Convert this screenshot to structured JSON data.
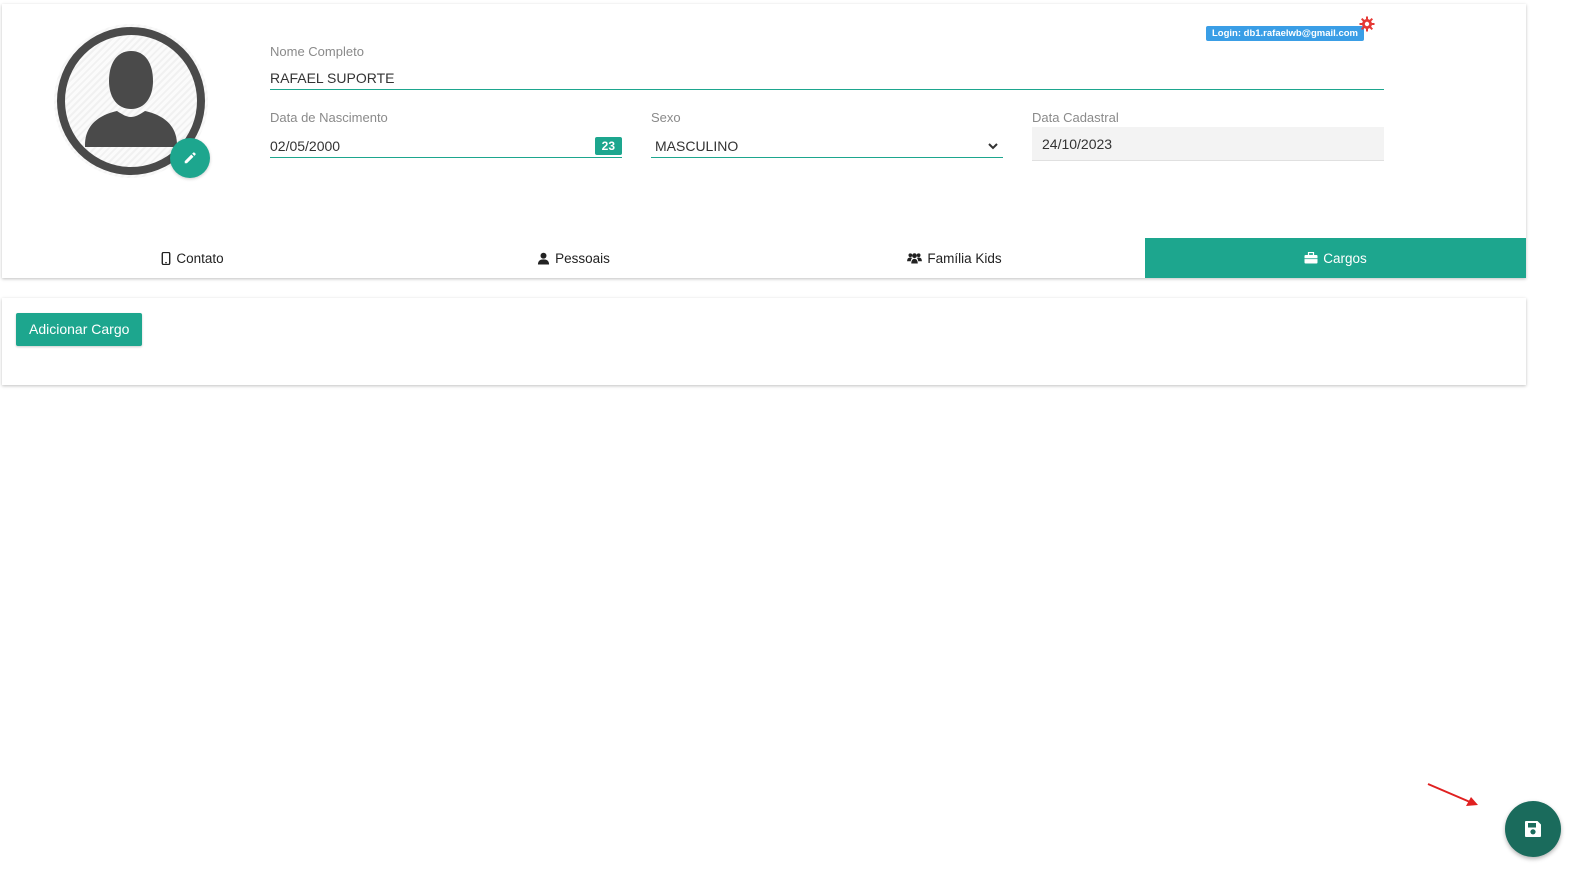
{
  "profile": {
    "avatar_icon": "user-silhouette-icon",
    "edit_photo_icon": "pencil-icon",
    "login_badge": "Login: db1.rafaelwb@gmail.com",
    "settings_icon": "gear-icon"
  },
  "form": {
    "name": {
      "label": "Nome Completo",
      "value": "RAFAEL SUPORTE"
    },
    "birth": {
      "label": "Data de Nascimento",
      "value": "02/05/2000",
      "age": "23"
    },
    "sex": {
      "label": "Sexo",
      "value": "MASCULINO"
    },
    "created": {
      "label": "Data Cadastral",
      "value": "24/10/2023"
    }
  },
  "tabs": [
    {
      "label": "Contato",
      "icon": "mobile-phone-icon",
      "active": false
    },
    {
      "label": "Pessoais",
      "icon": "user-icon",
      "active": false
    },
    {
      "label": "Família Kids",
      "icon": "users-icon",
      "active": false
    },
    {
      "label": "Cargos",
      "icon": "briefcase-icon",
      "active": true
    }
  ],
  "cargo": {
    "add_button": "Adicionar Cargo"
  },
  "fab": {
    "icon": "save-icon"
  },
  "colors": {
    "accent": "#1da68e",
    "fab": "#1a6b5c",
    "badge": "#3a9ee6",
    "gear": "#e53935"
  }
}
